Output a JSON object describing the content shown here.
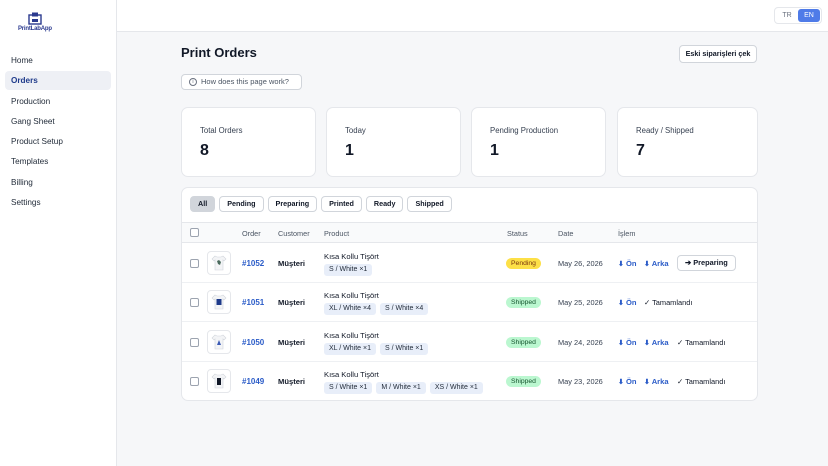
{
  "brand": {
    "name": "PrintLabApp"
  },
  "sidebar": {
    "items": [
      {
        "label": "Home",
        "active": false
      },
      {
        "label": "Orders",
        "active": true
      },
      {
        "label": "Production",
        "active": false
      },
      {
        "label": "Gang Sheet",
        "active": false
      },
      {
        "label": "Product Setup",
        "active": false
      },
      {
        "label": "Templates",
        "active": false
      },
      {
        "label": "Billing",
        "active": false
      },
      {
        "label": "Settings",
        "active": false
      }
    ]
  },
  "topbar": {
    "languages": [
      {
        "code": "TR",
        "selected": false
      },
      {
        "code": "EN",
        "selected": true
      }
    ]
  },
  "page": {
    "title": "Print Orders",
    "old_orders_button": "Eski siparişleri çek",
    "help_button": "How does this page work?",
    "help_icon": "i"
  },
  "stats": [
    {
      "label": "Total Orders",
      "value": "8"
    },
    {
      "label": "Today",
      "value": "1"
    },
    {
      "label": "Pending Production",
      "value": "1"
    },
    {
      "label": "Ready / Shipped",
      "value": "7"
    }
  ],
  "filters": [
    "All",
    "Pending",
    "Preparing",
    "Printed",
    "Ready",
    "Shipped"
  ],
  "active_filter": "All",
  "table": {
    "headers": {
      "order": "Order",
      "customer": "Customer",
      "product": "Product",
      "status": "Status",
      "date": "Date",
      "action": "İşlem"
    },
    "front_label": "Ön",
    "back_label": "Arka",
    "rows": [
      {
        "order": "#1052",
        "customer": "Müşteri",
        "product": "Kısa Kollu Tişört",
        "variants": [
          "S / White ×1"
        ],
        "status": "Pending",
        "date": "May 26, 2026",
        "next_action": "➔ Preparing",
        "done": ""
      },
      {
        "order": "#1051",
        "customer": "Müşteri",
        "product": "Kısa Kollu Tişört",
        "variants": [
          "XL / White ×4",
          "S / White ×4"
        ],
        "status": "Shipped",
        "date": "May 25, 2026",
        "next_action": "",
        "done": "✓ Tamamlandı"
      },
      {
        "order": "#1050",
        "customer": "Müşteri",
        "product": "Kısa Kollu Tişört",
        "variants": [
          "XL / White ×1",
          "S / White ×1"
        ],
        "status": "Shipped",
        "date": "May 24, 2026",
        "next_action": "",
        "done": "✓ Tamamlandı"
      },
      {
        "order": "#1049",
        "customer": "Müşteri",
        "product": "Kısa Kollu Tişört",
        "variants": [
          "S / White ×1",
          "M / White ×1",
          "XS / White ×1"
        ],
        "status": "Shipped",
        "date": "May 23, 2026",
        "next_action": "",
        "done": "✓ Tamamlandı"
      }
    ]
  },
  "colors": {
    "accent": "#4f7be8",
    "link": "#2b5cc8",
    "pending": "#fde047",
    "shipped": "#bbf7d0",
    "tag": "#e8eef9"
  }
}
